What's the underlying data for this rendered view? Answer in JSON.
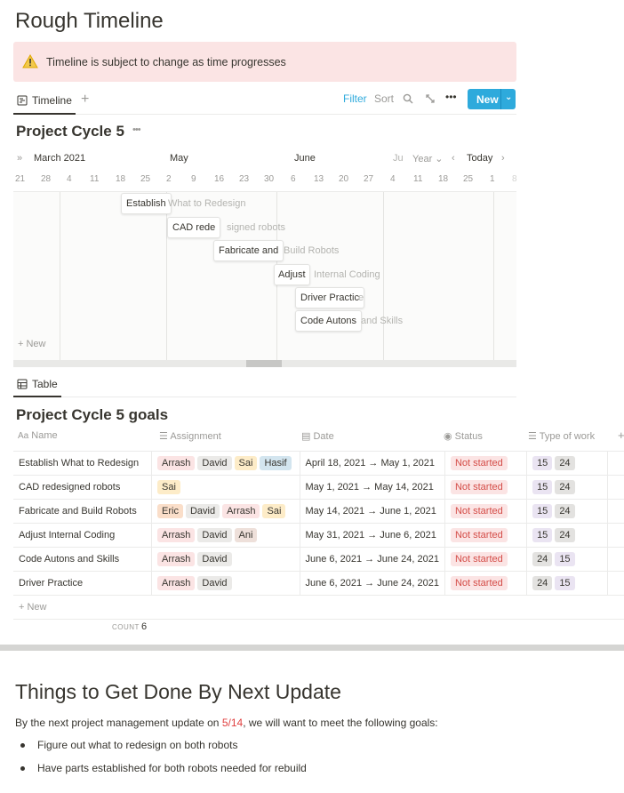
{
  "page": {
    "title": "Rough Timeline"
  },
  "callout": {
    "icon": "warning-icon",
    "text": "Timeline is subject to change as time progresses"
  },
  "timeline_view": {
    "tab_label": "Timeline",
    "toolbar": {
      "filter": "Filter",
      "sort": "Sort",
      "new": "New"
    },
    "heading": "Project Cycle 5",
    "more": "•••",
    "months": [
      "March 2021",
      "May",
      "June",
      "Ju"
    ],
    "scale": "Year",
    "today": "Today",
    "days": [
      "21",
      "28",
      "4",
      "11",
      "18",
      "25",
      "2",
      "9",
      "16",
      "23",
      "30",
      "6",
      "13",
      "20",
      "27",
      "4",
      "11",
      "18",
      "25",
      "1",
      "8"
    ],
    "bars": [
      {
        "inside": "Establish",
        "outside": "What to Redesign"
      },
      {
        "inside": "CAD rede",
        "outside": "signed robots"
      },
      {
        "inside": "Fabricate and",
        "outside": "Build Robots"
      },
      {
        "inside": "Adjust",
        "outside": "Internal Coding"
      },
      {
        "inside": "Driver Practic",
        "outside": "e"
      },
      {
        "inside": "Code Autons",
        "outside": "and Skills"
      }
    ],
    "add_new": "New"
  },
  "table_view": {
    "tab_label": "Table",
    "heading": "Project Cycle 5 goals",
    "columns": {
      "name": "Name",
      "assignment": "Assignment",
      "date": "Date",
      "status": "Status",
      "type": "Type of work"
    },
    "rows": [
      {
        "name": "Establish What to Redesign",
        "assign": [
          "Arrash",
          "David",
          "Sai",
          "Hasif"
        ],
        "date": "April 18, 2021 → May 1, 2021",
        "status": "Not started",
        "type": [
          "15",
          "24"
        ]
      },
      {
        "name": "CAD redesigned robots",
        "assign": [
          "Sai"
        ],
        "date": "May 1, 2021 → May 14, 2021",
        "status": "Not started",
        "type": [
          "15",
          "24"
        ]
      },
      {
        "name": "Fabricate and Build Robots",
        "assign": [
          "Eric",
          "David",
          "Arrash",
          "Sai"
        ],
        "date": "May 14, 2021 → June 1, 2021",
        "status": "Not started",
        "type": [
          "15",
          "24"
        ]
      },
      {
        "name": "Adjust Internal Coding",
        "assign": [
          "Arrash",
          "David",
          "Ani"
        ],
        "date": "May 31, 2021 → June 6, 2021",
        "status": "Not started",
        "type": [
          "15",
          "24"
        ]
      },
      {
        "name": "Code Autons and Skills",
        "assign": [
          "Arrash",
          "David"
        ],
        "date": "June 6, 2021 → June 24, 2021",
        "status": "Not started",
        "type": [
          "24",
          "15"
        ]
      },
      {
        "name": "Driver Practice",
        "assign": [
          "Arrash",
          "David"
        ],
        "date": "June 6, 2021 → June 24, 2021",
        "status": "Not started",
        "type": [
          "24",
          "15"
        ]
      }
    ],
    "add_new": "New",
    "count_label": "COUNT",
    "count_value": "6"
  },
  "section2": {
    "heading": "Things to Get Done By Next Update",
    "para_before": "By the next project management update on ",
    "para_date": "5/14",
    "para_after": ", we will want to meet the following goals:",
    "bullets": [
      "Figure out what to redesign on both robots",
      "Have parts established for both robots needed for rebuild"
    ]
  },
  "colors": {
    "accent": "#2eaadc",
    "status_red": "#d44c47",
    "callout_bg": "#fbe4e4"
  }
}
